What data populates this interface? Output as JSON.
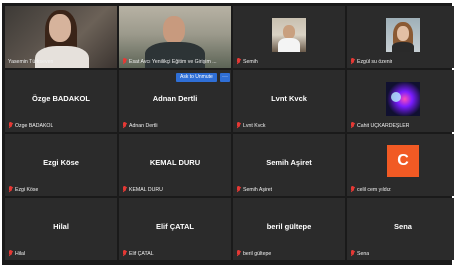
{
  "participants": [
    {
      "name": "Yasemin Türkseven",
      "display": "",
      "kind": "video"
    },
    {
      "name": "Esat Avcı Yenilikçi Eğitim ve Girişim ...",
      "display": "",
      "kind": "video"
    },
    {
      "name": "Semih",
      "display": "",
      "kind": "photo"
    },
    {
      "name": "Ezgül su özenir",
      "display": "",
      "kind": "photo"
    },
    {
      "name": "Özge BADAKOL",
      "display": "Özge BADAKOL",
      "kind": "name"
    },
    {
      "name": "Adnan Dertli",
      "display": "Adnan Dertli",
      "kind": "name"
    },
    {
      "name": "Lvnt Kvck",
      "display": "Lvnt Kvck",
      "kind": "name"
    },
    {
      "name": "Cahit ÜÇKARDEŞLER",
      "display": "",
      "kind": "photo"
    },
    {
      "name": "Ezgi Köse",
      "display": "Ezgi Köse",
      "kind": "name"
    },
    {
      "name": "KEMAL DURU",
      "display": "KEMAL DURU",
      "kind": "name"
    },
    {
      "name": "Semih Aşiret",
      "display": "Semih Aşiret",
      "kind": "name"
    },
    {
      "name": "celil cem yıldız",
      "display": "",
      "kind": "initial",
      "initial": "C"
    },
    {
      "name": "Hilal",
      "display": "Hilal",
      "kind": "name"
    },
    {
      "name": "Elif ÇATAL",
      "display": "Elif ÇATAL",
      "kind": "name"
    },
    {
      "name": "beril gültepe",
      "display": "beril gültepe",
      "kind": "name"
    },
    {
      "name": "Sena",
      "display": "Sena",
      "kind": "name"
    }
  ],
  "actions": {
    "ask_to_unmute": "Ask to Unmute",
    "more": "···"
  },
  "colors": {
    "active_speaker": "#d9e86a",
    "mute_icon": "#e53935",
    "button": "#2f6fd6",
    "avatar": "#f15a24"
  }
}
